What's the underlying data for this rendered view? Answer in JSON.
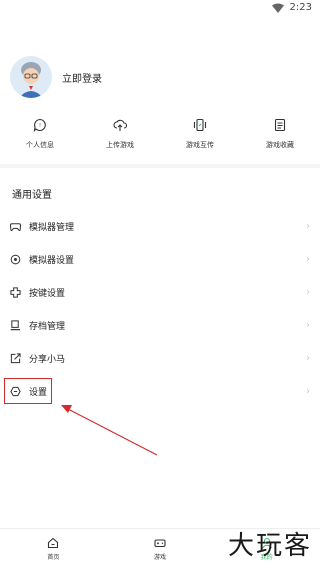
{
  "status_bar": {
    "time": "2:23",
    "wifi_icon": "wifi-icon"
  },
  "profile": {
    "login_text": "立即登录",
    "avatar_icon": "avatar-icon"
  },
  "quick_actions": [
    {
      "label": "个人信息",
      "icon": "chat-icon"
    },
    {
      "label": "上传游戏",
      "icon": "cloud-upload-icon"
    },
    {
      "label": "游戏互传",
      "icon": "phone-transfer-icon"
    },
    {
      "label": "游戏收藏",
      "icon": "list-icon"
    }
  ],
  "section": {
    "title": "通用设置"
  },
  "menu": [
    {
      "label": "模拟器管理",
      "icon": "gamepad-icon"
    },
    {
      "label": "模拟器设置",
      "icon": "gear-icon"
    },
    {
      "label": "按键设置",
      "icon": "dpad-icon"
    },
    {
      "label": "存档管理",
      "icon": "archive-icon"
    },
    {
      "label": "分享小马",
      "icon": "share-icon"
    },
    {
      "label": "设置",
      "icon": "settings-icon"
    }
  ],
  "chevron": "›",
  "bottom_nav": [
    {
      "label": "首页",
      "icon": "home-icon"
    },
    {
      "label": "游戏",
      "icon": "gamepad-icon"
    },
    {
      "label": "我的",
      "icon": "user-icon",
      "active": true
    }
  ],
  "watermark": "大玩客",
  "colors": {
    "accent": "#38b46a",
    "annotation": "#d12b2b"
  }
}
